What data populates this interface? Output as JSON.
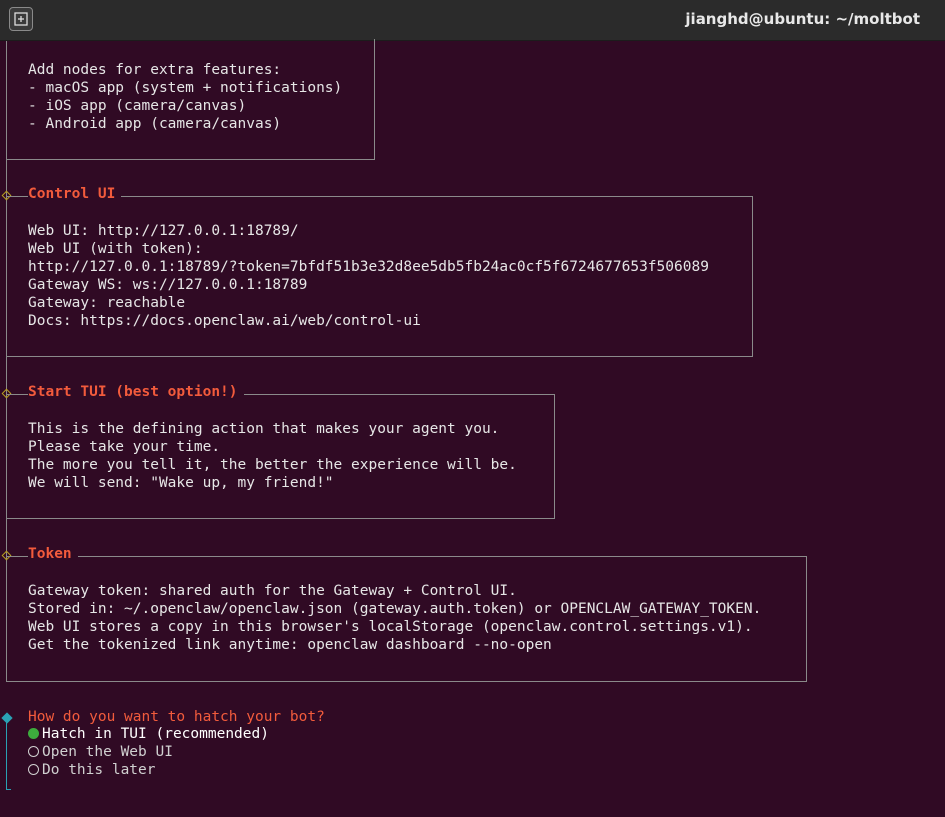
{
  "window": {
    "title": "jianghd@ubuntu: ~/moltbot"
  },
  "colors": {
    "background": "#300a24",
    "section_title": "#f25b3c",
    "border": "#8a8a8a",
    "done_diamond": "#b8a020",
    "active_diamond": "#2aa1b3",
    "radio_selected": "#3dab3d"
  },
  "nodes_box": {
    "lines": [
      "Add nodes for extra features:",
      "- macOS app (system + notifications)",
      "- iOS app (camera/canvas)",
      "- Android app (camera/canvas)"
    ]
  },
  "control_ui": {
    "title": "Control UI",
    "lines": [
      "Web UI: http://127.0.0.1:18789/",
      "Web UI (with token):",
      "http://127.0.0.1:18789/?token=7bfdf51b3e32d8ee5db5fb24ac0cf5f6724677653f506089",
      "Gateway WS: ws://127.0.0.1:18789",
      "Gateway: reachable",
      "Docs: https://docs.openclaw.ai/web/control-ui"
    ]
  },
  "start_tui": {
    "title": "Start TUI (best option!)",
    "lines": [
      "This is the defining action that makes your agent you.",
      "Please take your time.",
      "The more you tell it, the better the experience will be.",
      "We will send: \"Wake up, my friend!\""
    ]
  },
  "token": {
    "title": "Token",
    "lines": [
      "Gateway token: shared auth for the Gateway + Control UI.",
      "Stored in: ~/.openclaw/openclaw.json (gateway.auth.token) or OPENCLAW_GATEWAY_TOKEN.",
      "Web UI stores a copy in this browser's localStorage (openclaw.control.settings.v1).",
      "Get the tokenized link anytime: openclaw dashboard --no-open"
    ]
  },
  "hatch_prompt": {
    "question": "How do you want to hatch your bot?",
    "options": [
      {
        "label": "Hatch in TUI (recommended)",
        "selected": true
      },
      {
        "label": "Open the Web UI",
        "selected": false
      },
      {
        "label": "Do this later",
        "selected": false
      }
    ]
  }
}
